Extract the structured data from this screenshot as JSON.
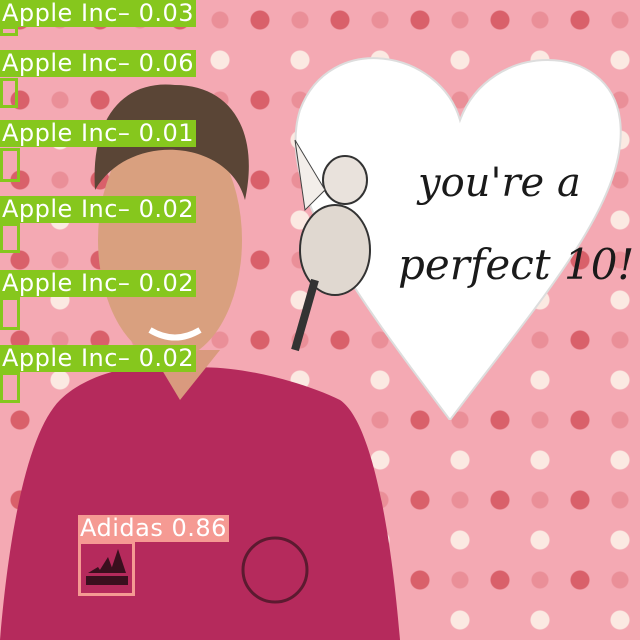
{
  "scene_text": {
    "card_line1": "you're a",
    "card_line2": "perfect 10!"
  },
  "detections": [
    {
      "label": "Apple Inc– 0.03",
      "class": "Apple Inc",
      "score": 0.03,
      "color": "#86c71d"
    },
    {
      "label": "Apple Inc– 0.06",
      "class": "Apple Inc",
      "score": 0.06,
      "color": "#86c71d"
    },
    {
      "label": "Apple Inc– 0.01",
      "class": "Apple Inc",
      "score": 0.01,
      "color": "#86c71d"
    },
    {
      "label": "Apple Inc– 0.02",
      "class": "Apple Inc",
      "score": 0.02,
      "color": "#86c71d"
    },
    {
      "label": "Apple Inc– 0.02",
      "class": "Apple Inc",
      "score": 0.02,
      "color": "#86c71d"
    },
    {
      "label": "Apple Inc– 0.02",
      "class": "Apple Inc",
      "score": 0.02,
      "color": "#86c71d"
    },
    {
      "label": "Adidas 0.86",
      "class": "Adidas",
      "score": 0.86,
      "color": "#f59a93"
    }
  ]
}
